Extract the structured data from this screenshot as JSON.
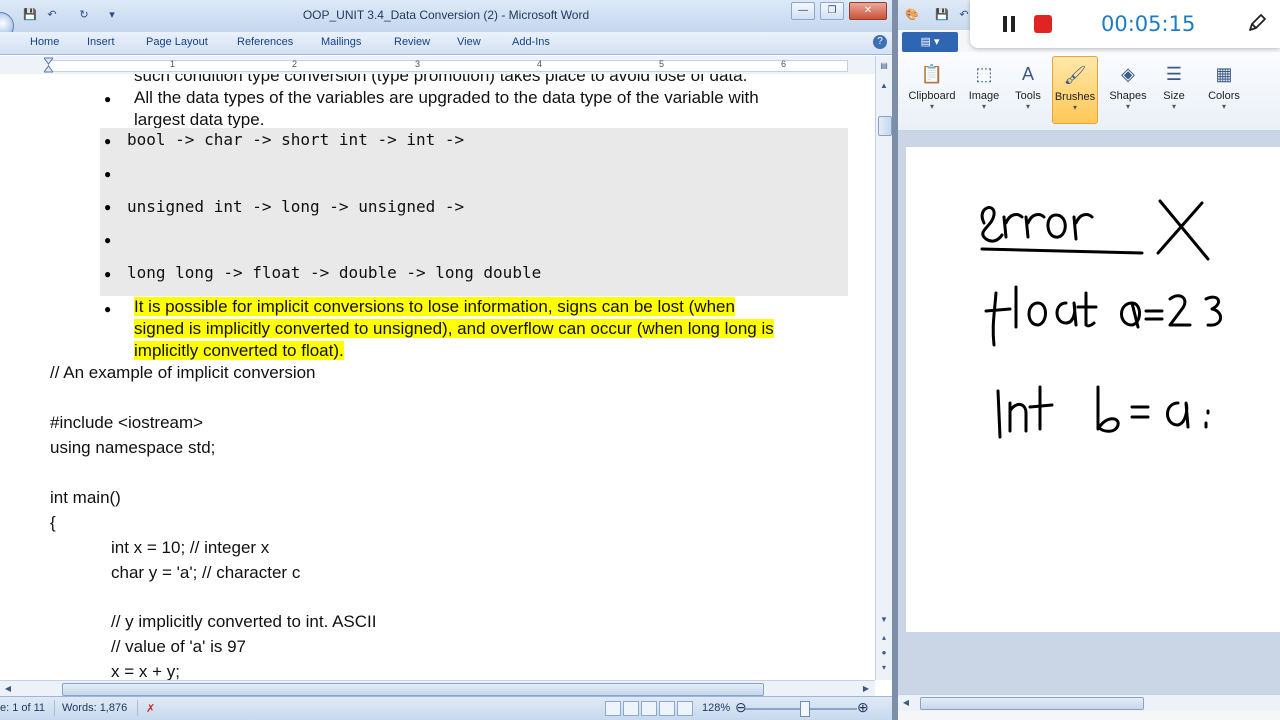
{
  "word": {
    "title": "OOP_UNIT 3.4_Data Conversion (2) - Microsoft Word",
    "tabs": [
      "Home",
      "Insert",
      "Page Layout",
      "References",
      "Mailings",
      "Review",
      "View",
      "Add-Ins"
    ],
    "ruler_numbers": [
      "1",
      "2",
      "3",
      "4",
      "5",
      "6"
    ],
    "document": {
      "cut_line": "such condition type conversion (type promotion) takes place to avoid lose of data.",
      "bullet1_line1": "All the data types of the variables are upgraded to the data type of the variable with",
      "bullet1_line2": "largest data type.",
      "code_bullets": [
        "bool -> char -> short int -> int ->",
        "",
        "unsigned int -> long -> unsigned ->",
        "",
        "long long -> float -> double -> long double"
      ],
      "hl_line1": "It is possible for implicit conversions to lose information, signs can be lost (when",
      "hl_line2": "signed is implicitly  converted to unsigned), and overflow can occur (when long long is",
      "hl_line3": "implicitly converted to float).",
      "code_lines": [
        "// An example of implicit conversion",
        "#include <iostream>",
        "using namespace std;",
        "int main()",
        "{",
        "int x = 10; // integer x",
        "char y = 'a'; // character c",
        "// y implicitly converted to int. ASCII",
        "// value of 'a' is 97",
        "x = x + y;"
      ]
    },
    "status": {
      "page": "e: 1 of 11",
      "words": "Words: 1,876",
      "zoom": "128%"
    }
  },
  "paint": {
    "menu_label": "▤ ▾",
    "tools": [
      "Clipboard",
      "Image",
      "Tools",
      "Brushes",
      "Shapes",
      "Size",
      "Colors"
    ],
    "handwriting": [
      "error X",
      "float a = 2.3",
      "int b = a ;"
    ]
  },
  "recorder": {
    "timer": "00:05:15",
    "stop_color": "#e02424",
    "timer_color": "#1f7cc3"
  }
}
